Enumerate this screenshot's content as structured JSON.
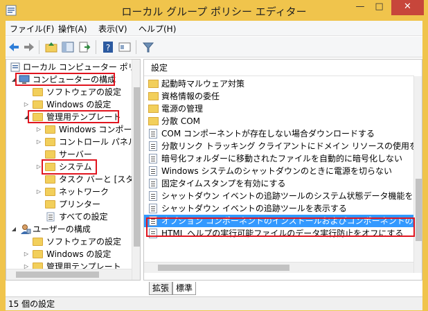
{
  "window": {
    "title": "ローカル グループ ポリシー エディター",
    "min_glyph": "—",
    "max_glyph": "□",
    "close_glyph": "✕"
  },
  "menu": {
    "items": [
      {
        "label": "ファイル(F)"
      },
      {
        "label": "操作(A)"
      },
      {
        "label": "表示(V)"
      },
      {
        "label": "ヘルプ(H)"
      }
    ]
  },
  "tree": {
    "items": [
      {
        "label": "ローカル コンピューター ポリシー",
        "arrow": ""
      },
      {
        "label": "コンピューターの構成",
        "arrow": "◢"
      },
      {
        "label": "ソフトウェアの設定",
        "arrow": ""
      },
      {
        "label": "Windows の設定",
        "arrow": "▷"
      },
      {
        "label": "管理用テンプレート",
        "arrow": "◢"
      },
      {
        "label": "Windows コンポー",
        "arrow": "▷"
      },
      {
        "label": "コントロール パネル",
        "arrow": "▷"
      },
      {
        "label": "サーバー",
        "arrow": ""
      },
      {
        "label": "システム",
        "arrow": "▷"
      },
      {
        "label": "タスク バーと [スター",
        "arrow": ""
      },
      {
        "label": "ネットワーク",
        "arrow": "▷"
      },
      {
        "label": "プリンター",
        "arrow": ""
      },
      {
        "label": "すべての設定",
        "arrow": ""
      },
      {
        "label": "ユーザーの構成",
        "arrow": "◢"
      },
      {
        "label": "ソフトウェアの設定",
        "arrow": ""
      },
      {
        "label": "Windows の設定",
        "arrow": "▷"
      },
      {
        "label": "管理用テンプレート",
        "arrow": "▷"
      }
    ]
  },
  "list": {
    "header": "設定",
    "items": [
      {
        "label": "起動時マルウェア対策",
        "kind": "folder"
      },
      {
        "label": "資格情報の委任",
        "kind": "folder"
      },
      {
        "label": "電源の管理",
        "kind": "folder"
      },
      {
        "label": "分散 COM",
        "kind": "folder"
      },
      {
        "label": "COM コンポーネントが存在しない場合ダウンロードする",
        "kind": "setting"
      },
      {
        "label": "分散リンク トラッキング クライアントにドメイン リソースの使用を許可する",
        "kind": "setting"
      },
      {
        "label": "暗号化フォルダーに移動されたファイルを自動的に暗号化しない",
        "kind": "setting"
      },
      {
        "label": "Windows システムのシャットダウンのときに電源を切らない",
        "kind": "setting"
      },
      {
        "label": "固定タイムスタンプを有効にする",
        "kind": "setting"
      },
      {
        "label": "シャットダウン イベントの追跡ツールのシステム状態データ機能をアク...",
        "kind": "setting"
      },
      {
        "label": "シャットダウン イベントの追跡ツールを表示する",
        "kind": "setting"
      },
      {
        "label": "オプション コンポーネントのインストールおよびコンポーネントの修復の...",
        "kind": "setting"
      },
      {
        "label": "HTML ヘルプの実行可能ファイルのデータ実行防止をオフにする",
        "kind": "setting"
      }
    ]
  },
  "tabs": [
    {
      "label": "拡張"
    },
    {
      "label": "標準"
    }
  ],
  "status": {
    "text": "15 個の設定"
  },
  "colors": {
    "titlebar": "#f0c44c",
    "close": "#c7463b",
    "selection": "#3399ff",
    "annotation": "#e0141e"
  }
}
